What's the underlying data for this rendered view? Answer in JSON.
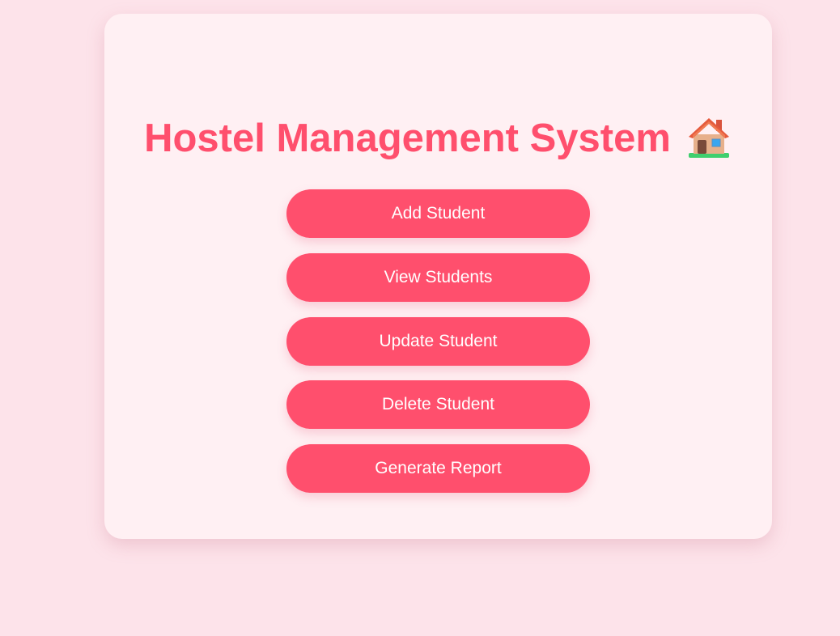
{
  "header": {
    "title": "Hostel Management System",
    "icon": "house-icon"
  },
  "menu": {
    "buttons": [
      {
        "label": "Add Student"
      },
      {
        "label": "View Students"
      },
      {
        "label": "Update Student"
      },
      {
        "label": "Delete Student"
      },
      {
        "label": "Generate Report"
      }
    ]
  },
  "colors": {
    "background": "#fde3ea",
    "card": "#fff0f3",
    "accent": "#ff4f6d",
    "button_text": "#ffffff"
  }
}
